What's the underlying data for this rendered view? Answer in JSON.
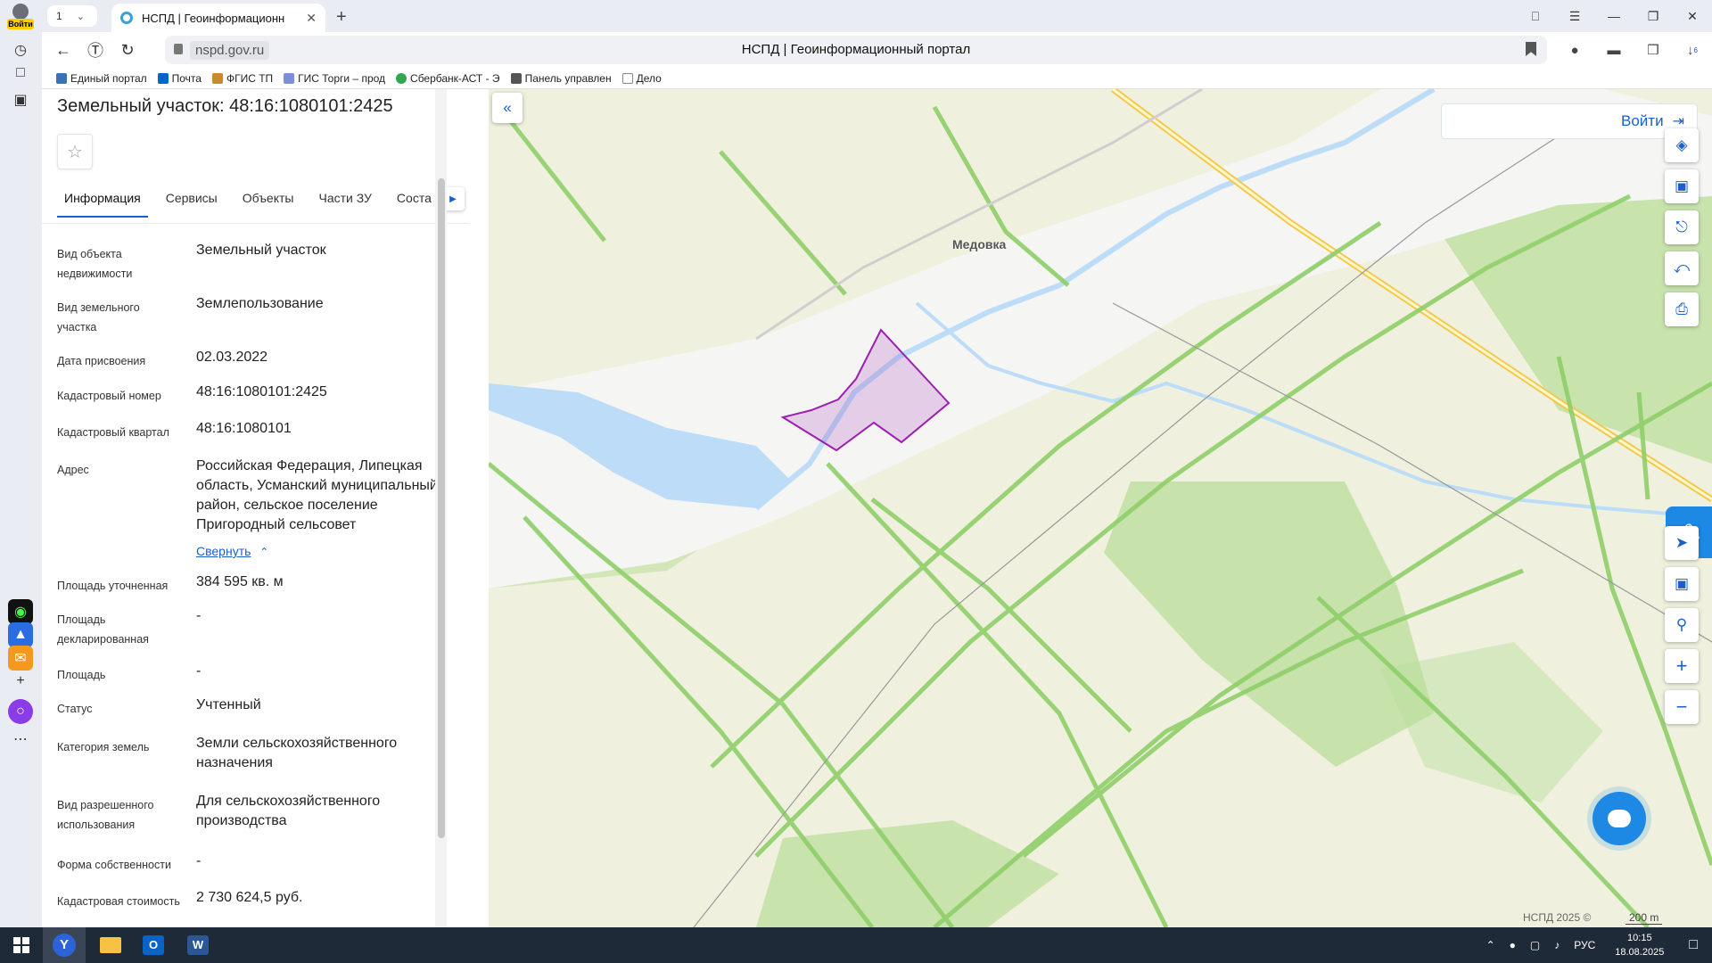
{
  "browser": {
    "login_label": "Войти",
    "tab_count": "1",
    "tab_title": "НСПД | Геоинформационн",
    "url": "nspd.gov.ru",
    "page_title": "НСПД | Геоинформационный портал",
    "downloads_badge": "6",
    "bookmarks": [
      {
        "label": "Единый портал",
        "color": "#3b6fb6"
      },
      {
        "label": "Почта",
        "color": "#0a64c8"
      },
      {
        "label": "ФГИС ТП",
        "color": "#c88a2a"
      },
      {
        "label": "ГИС Торги – прод",
        "color": "#7c8fd8"
      },
      {
        "label": "Сбербанк-АСТ - Э",
        "color": "#2fa84f"
      },
      {
        "label": "Панель управлен",
        "color": "#555555"
      },
      {
        "label": "Дело",
        "color": "#888888"
      }
    ]
  },
  "panel": {
    "title": "Земельный участок: 48:16:1080101:2425",
    "tabs": [
      "Информация",
      "Сервисы",
      "Объекты",
      "Части ЗУ",
      "Соста"
    ],
    "collapse_label": "Свернуть",
    "rows": [
      {
        "label": "Вид объекта недвижимости",
        "value": "Земельный участок"
      },
      {
        "label": "Вид земельного участка",
        "value": "Землепользование"
      },
      {
        "label": "Дата присвоения",
        "value": "02.03.2022"
      },
      {
        "label": "Кадастровый номер",
        "value": "48:16:1080101:2425"
      },
      {
        "label": "Кадастровый квартал",
        "value": "48:16:1080101"
      },
      {
        "label": "Адрес",
        "value": "Российская Федерация, Липецкая область, Усманский муниципальный район, сельское поселение Пригородный сельсовет"
      },
      {
        "label": "Площадь уточненная",
        "value": "384 595 кв. м"
      },
      {
        "label": "Площадь декларированная",
        "value": "-"
      },
      {
        "label": "Площадь",
        "value": "-"
      },
      {
        "label": "Статус",
        "value": "Учтенный"
      },
      {
        "label": "Категория земель",
        "value": "Земли сельскохозяйственного назначения"
      },
      {
        "label": "Вид разрешенного использования",
        "value": "Для сельскохозяйственного производства"
      },
      {
        "label": "Форма собственности",
        "value": "-"
      },
      {
        "label": "Кадастровая стоимость",
        "value": "2 730 624,5 руб."
      }
    ]
  },
  "map": {
    "login_label": "Войти",
    "village_label": "Медовка",
    "copyright": "НСПД 2025 ©",
    "scale_label": "200 m",
    "parcel_color": "#9b1fb0",
    "water_color": "#bcdcf7",
    "field_color": "#f0f1e2",
    "forest_color": "#b9dd99"
  },
  "taskbar": {
    "lang": "РУС",
    "time": "10:15",
    "date": "18.08.2025"
  }
}
